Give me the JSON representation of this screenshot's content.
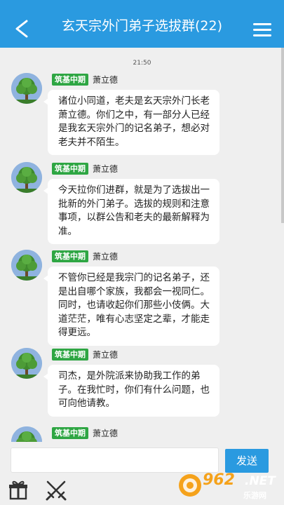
{
  "header": {
    "title": "玄天宗外门弟子选拔群(22)"
  },
  "chat": {
    "timestamp": "21:50",
    "messages": [
      {
        "badge": "筑基中期",
        "sender": "萧立德",
        "text": "诸位小同道，老夫是玄天宗外门长老萧立德。你们之中，有一部分人已经是我玄天宗外门的记名弟子，想必对老夫并不陌生。"
      },
      {
        "badge": "筑基中期",
        "sender": "萧立德",
        "text": "今天拉你们进群，就是为了选拔出一批新的外门弟子。选拔的规则和注意事项，以群公告和老夫的最新解释为准。"
      },
      {
        "badge": "筑基中期",
        "sender": "萧立德",
        "text": "不管你已经是我宗门的记名弟子，还是出自哪个家族，我都会一视同仁。同时，也请收起你们那些小伎俩。大道茫茫，唯有心志坚定之辈，才能走得更远。"
      },
      {
        "badge": "筑基中期",
        "sender": "萧立德",
        "text": "司杰，是外院派来协助我工作的弟子。在我忙时，你们有什么问题，也可向他请教。"
      },
      {
        "badge": "筑基中期",
        "sender": "萧立德",
        "text": ""
      }
    ]
  },
  "input": {
    "value": "",
    "placeholder": "",
    "send_label": "发送"
  },
  "watermark": {
    "number": "962",
    "suffix": ".NET",
    "site": "乐游网"
  },
  "colors": {
    "header": "#2a9ae0",
    "badge": "#2ea643",
    "background": "#efefef"
  },
  "icons": [
    "back-arrow-icon",
    "menu-icon",
    "gift-icon",
    "crossed-swords-icon"
  ]
}
